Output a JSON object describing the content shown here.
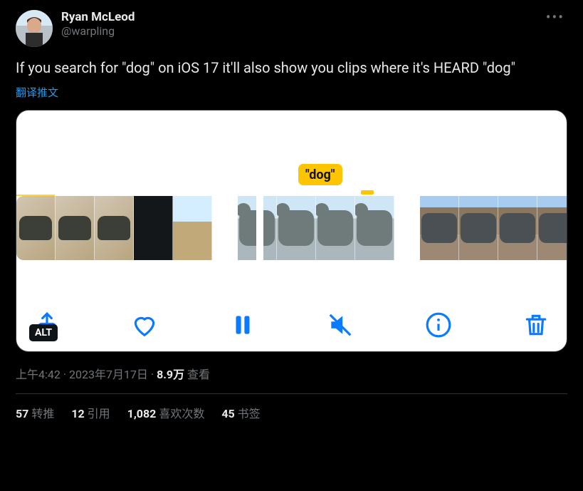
{
  "header": {
    "display_name": "Ryan McLeod",
    "handle": "@warpling"
  },
  "body": {
    "text": "If you search for \"dog\" on iOS 17 it'll also show you clips where it's HEARD \"dog\"",
    "translate_label": "翻译推文"
  },
  "media": {
    "bubble_label": "\"dog\"",
    "alt_label": "ALT"
  },
  "meta": {
    "time": "上午4:42",
    "dot": " · ",
    "date": "2023年7月17日",
    "views_count": "8.9万",
    "views_label": " 查看"
  },
  "stats": {
    "retweets": {
      "count": "57",
      "label": "转推"
    },
    "quotes": {
      "count": "12",
      "label": "引用"
    },
    "likes": {
      "count": "1,082",
      "label": "喜欢次数"
    },
    "bookmarks": {
      "count": "45",
      "label": "书签"
    }
  }
}
